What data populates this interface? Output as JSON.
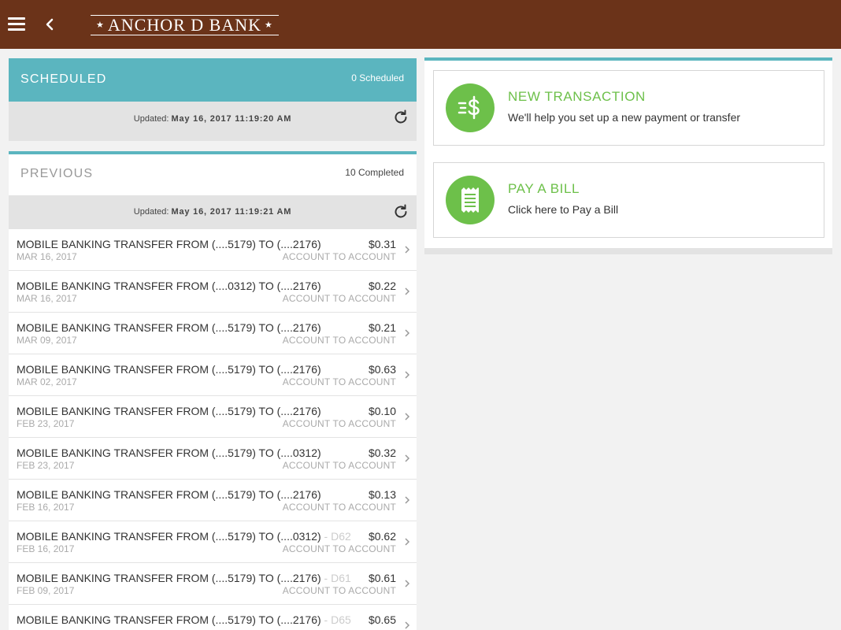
{
  "header": {
    "bank_name": "ANCHOR D BANK",
    "star_glyph": "★"
  },
  "scheduled": {
    "title": "SCHEDULED",
    "count": "0 Scheduled",
    "updated_label": "Updated:",
    "updated_value": "May 16, 2017 11:19:20 AM"
  },
  "previous": {
    "title": "PREVIOUS",
    "count": "10 Completed",
    "updated_label": "Updated:",
    "updated_value": "May 16, 2017 11:19:21 AM",
    "transactions": [
      {
        "desc": "MOBILE BANKING TRANSFER FROM (....5179) TO (....2176)",
        "desc_faded": "",
        "date": "MAR 16, 2017",
        "amount": "$0.31",
        "type": "ACCOUNT TO ACCOUNT"
      },
      {
        "desc": "MOBILE BANKING TRANSFER FROM (....0312) TO (....2176)",
        "desc_faded": "",
        "date": "MAR 16, 2017",
        "amount": "$0.22",
        "type": "ACCOUNT TO ACCOUNT"
      },
      {
        "desc": "MOBILE BANKING TRANSFER FROM (....5179) TO (....2176)",
        "desc_faded": "",
        "date": "MAR 09, 2017",
        "amount": "$0.21",
        "type": "ACCOUNT TO ACCOUNT"
      },
      {
        "desc": "MOBILE BANKING TRANSFER FROM (....5179) TO (....2176)",
        "desc_faded": "",
        "date": "MAR 02, 2017",
        "amount": "$0.63",
        "type": "ACCOUNT TO ACCOUNT"
      },
      {
        "desc": "MOBILE BANKING TRANSFER FROM (....5179) TO (....2176)",
        "desc_faded": "",
        "date": "FEB 23, 2017",
        "amount": "$0.10",
        "type": "ACCOUNT TO ACCOUNT"
      },
      {
        "desc": "MOBILE BANKING TRANSFER FROM (....5179) TO (....0312)",
        "desc_faded": "",
        "date": "FEB 23, 2017",
        "amount": "$0.32",
        "type": "ACCOUNT TO ACCOUNT"
      },
      {
        "desc": "MOBILE BANKING TRANSFER FROM (....5179) TO (....2176)",
        "desc_faded": "",
        "date": "FEB 16, 2017",
        "amount": "$0.13",
        "type": "ACCOUNT TO ACCOUNT"
      },
      {
        "desc": "MOBILE BANKING TRANSFER FROM (....5179) TO (....0312)",
        "desc_faded": " - D62",
        "date": "FEB 16, 2017",
        "amount": "$0.62",
        "type": "ACCOUNT TO ACCOUNT"
      },
      {
        "desc": "MOBILE BANKING TRANSFER FROM (....5179) TO (....2176)",
        "desc_faded": " - D61",
        "date": "FEB 09, 2017",
        "amount": "$0.61",
        "type": "ACCOUNT TO ACCOUNT"
      },
      {
        "desc": "MOBILE BANKING TRANSFER FROM (....5179) TO (....2176)",
        "desc_faded": " - D65",
        "date": "",
        "amount": "$0.65",
        "type": ""
      }
    ]
  },
  "actions": {
    "new_transaction": {
      "title": "NEW TRANSACTION",
      "subtitle": "We'll help you set up a new payment or transfer",
      "icon": "dollar-transfer-icon"
    },
    "pay_bill": {
      "title": "PAY A BILL",
      "subtitle": "Click here to Pay a Bill",
      "icon": "receipt-icon"
    }
  },
  "colors": {
    "header_bg": "#6b3319",
    "accent_teal": "#5bb5bf",
    "action_green": "#6dc04a"
  }
}
